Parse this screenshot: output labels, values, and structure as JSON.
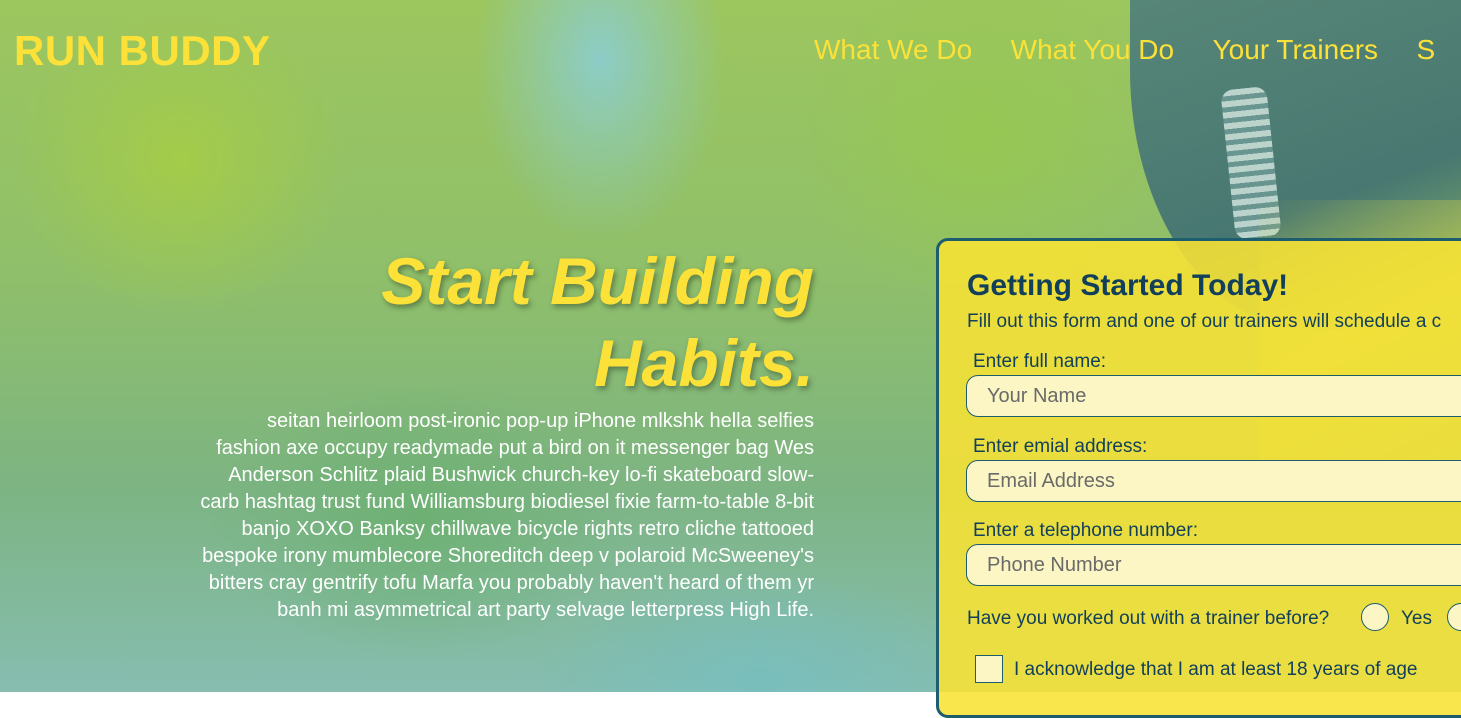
{
  "brand": {
    "name": "RUN BUDDY",
    "color": "#fce138"
  },
  "nav": {
    "items": [
      "What We Do",
      "What You Do",
      "Your Trainers",
      "S"
    ]
  },
  "hero": {
    "title_line1": "Start Building",
    "title_line2": "Habits.",
    "body": "seitan heirloom post-ironic pop-up iPhone mlkshk hella selfies fashion axe occupy readymade put a bird on it messenger bag Wes Anderson Schlitz plaid Bushwick church-key lo-fi skateboard slow-carb hashtag trust fund Williamsburg biodiesel fixie farm-to-table 8-bit banjo XOXO Banksy chillwave bicycle rights retro cliche tattooed bespoke irony mumblecore Shoreditch deep v polaroid McSweeney's bitters cray gentrify tofu Marfa you probably haven't heard of them yr banh mi asymmetrical art party selvage letterpress High Life."
  },
  "form": {
    "title": "Getting Started Today!",
    "intro": "Fill out this form and one of our trainers will schedule a c",
    "name_label": "Enter full name:",
    "name_placeholder": "Your Name",
    "email_label": "Enter emial address:",
    "email_placeholder": "Email Address",
    "phone_label": "Enter a telephone number:",
    "phone_placeholder": "Phone Number",
    "trainer_question": "Have you worked out with a trainer before?",
    "yes_label": "Yes",
    "age_ack": "I acknowledge that I am at least 18 years of age"
  },
  "colors": {
    "accent": "#fce138",
    "form_bg": "#f8e234",
    "form_text": "#12405a",
    "border": "#1d5d6e"
  }
}
